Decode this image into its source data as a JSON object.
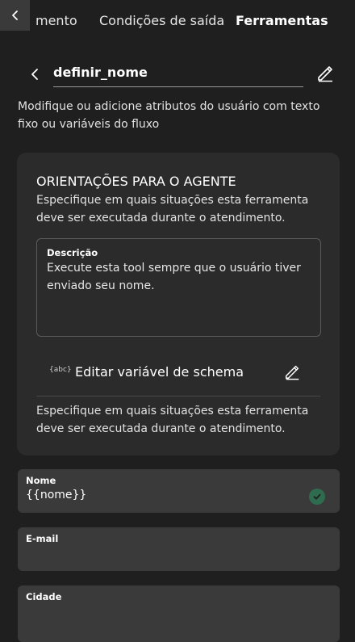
{
  "tabs": {
    "items": [
      {
        "label": "mento"
      },
      {
        "label": "Condições de saída"
      },
      {
        "label": "Ferramentas"
      }
    ]
  },
  "tool": {
    "name": "definir_nome",
    "description": "Modifique ou adicione atributos do usuário com texto fixo ou variáveis do fluxo"
  },
  "card": {
    "title": "ORIENTAÇÕES PARA O AGENTE",
    "subtitle": "Especifique em quais situações esta ferramenta deve ser executada durante o atendimento.",
    "textarea": {
      "label": "Descrição",
      "value": "Execute esta tool sempre que o usuário tiver enviado seu nome."
    },
    "schema_icon_text": "{abc}",
    "schema_label": "Editar variável de schema",
    "footer_text": "Especifique em quais situações esta ferramenta deve ser executada durante o atendimento."
  },
  "fields": [
    {
      "label": "Nome",
      "value": "{{nome}}"
    },
    {
      "label": "E-mail",
      "value": ""
    },
    {
      "label": "Cidade",
      "value": ""
    }
  ],
  "colors": {
    "background": "#1f1f1f",
    "card": "#2b2b2b",
    "field": "#3a3a3a",
    "check": "#2e6b4f"
  },
  "icons": [
    "chevron-left-icon",
    "pencil-icon",
    "abc-variable-icon",
    "check-circle-icon"
  ]
}
